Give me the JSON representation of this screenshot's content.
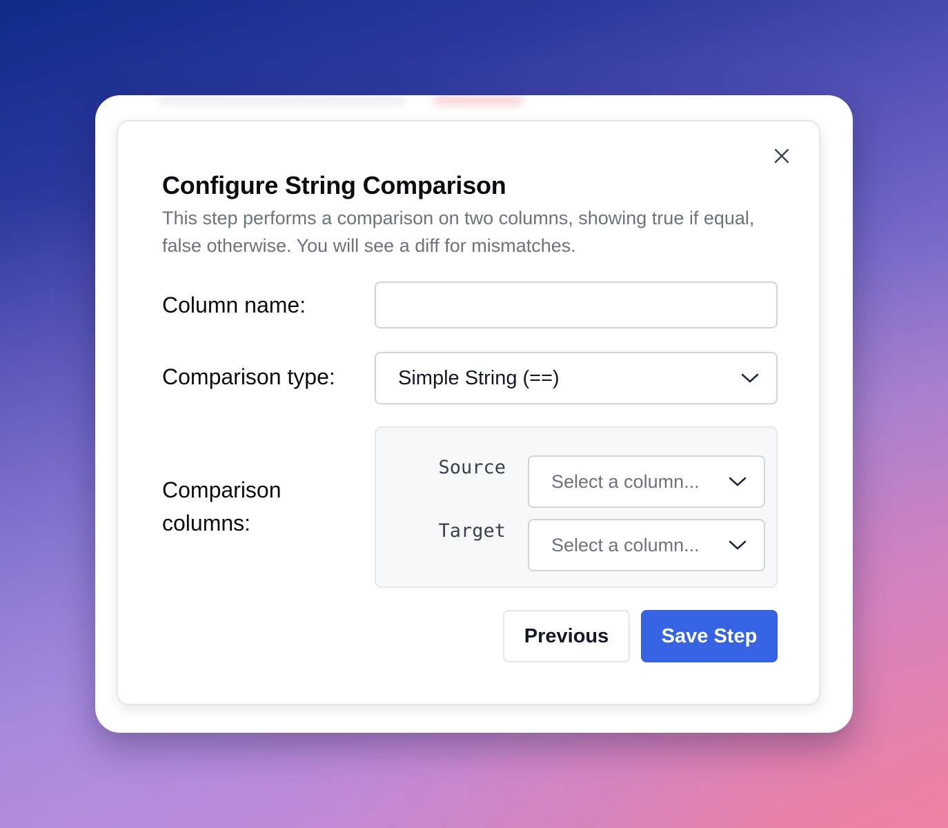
{
  "dialog": {
    "title": "Configure String Comparison",
    "description": "This step performs a comparison on two columns, showing true if equal, false otherwise. You will see a diff for mismatches.",
    "close_icon": "close-icon"
  },
  "form": {
    "column_name": {
      "label": "Column name:",
      "value": "",
      "placeholder": ""
    },
    "comparison_type": {
      "label": "Comparison type:",
      "selected": "Simple String (==)"
    },
    "comparison_columns": {
      "label": "Comparison columns:",
      "source": {
        "label": "Source",
        "placeholder": "Select a column..."
      },
      "target": {
        "label": "Target",
        "placeholder": "Select a column..."
      }
    }
  },
  "actions": {
    "previous_label": "Previous",
    "save_label": "Save Step"
  },
  "colors": {
    "primary": "#3563e3",
    "text": "#0b0b12",
    "muted": "#6b7280",
    "border": "#d1d5db"
  }
}
